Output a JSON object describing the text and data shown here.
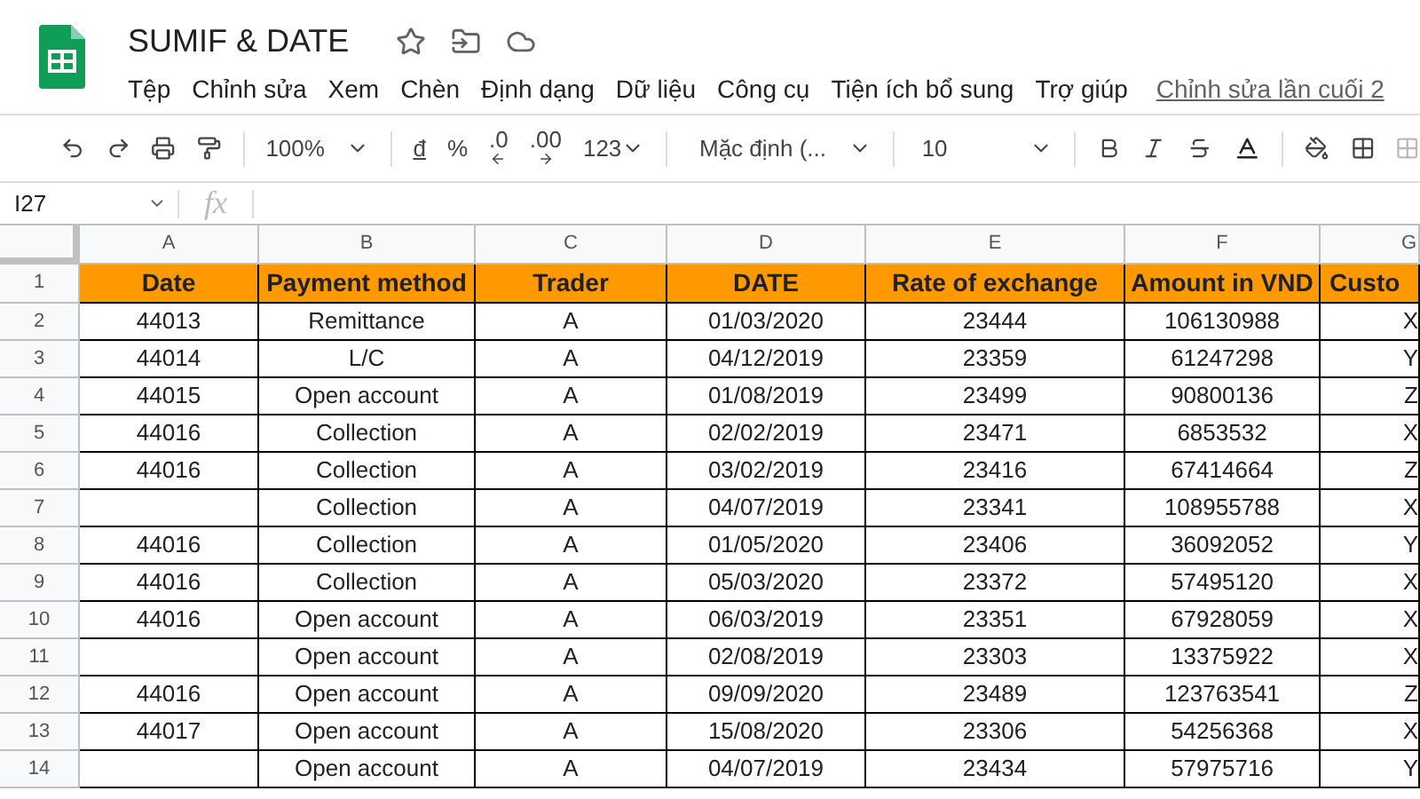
{
  "document": {
    "title": "SUMIF & DATE"
  },
  "menu": [
    "Tệp",
    "Chỉnh sửa",
    "Xem",
    "Chèn",
    "Định dạng",
    "Dữ liệu",
    "Công cụ",
    "Tiện ích bổ sung",
    "Trợ giúp"
  ],
  "last_edit": "Chỉnh sửa lần cuối 2",
  "toolbar": {
    "zoom": "100%",
    "currency": "đ",
    "percent": "%",
    "decrease_decimals": ".0",
    "increase_decimals": ".00",
    "number_format": "123",
    "font": "Mặc định (...",
    "font_size": "10"
  },
  "formula_bar": {
    "cell_ref": "I27",
    "fx": "fx"
  },
  "sheet": {
    "column_letters": [
      "A",
      "B",
      "C",
      "D",
      "E",
      "F",
      "G"
    ],
    "header": {
      "number": "1",
      "cells": [
        "Date",
        "Payment method",
        "Trader",
        "DATE",
        "Rate of exchange",
        "Amount in VND",
        "Custo"
      ]
    },
    "rows": [
      {
        "number": "2",
        "cells": [
          "44013",
          "Remittance",
          "A",
          "01/03/2020",
          "23444",
          "106130988",
          "X"
        ]
      },
      {
        "number": "3",
        "cells": [
          "44014",
          "L/C",
          "A",
          "04/12/2019",
          "23359",
          "61247298",
          "Y"
        ]
      },
      {
        "number": "4",
        "cells": [
          "44015",
          "Open account",
          "A",
          "01/08/2019",
          "23499",
          "90800136",
          "Z"
        ]
      },
      {
        "number": "5",
        "cells": [
          "44016",
          "Collection",
          "A",
          "02/02/2019",
          "23471",
          "6853532",
          "X"
        ]
      },
      {
        "number": "6",
        "cells": [
          "44016",
          "Collection",
          "A",
          "03/02/2019",
          "23416",
          "67414664",
          "Z"
        ]
      },
      {
        "number": "7",
        "cells": [
          "",
          "Collection",
          "A",
          "04/07/2019",
          "23341",
          "108955788",
          "X"
        ]
      },
      {
        "number": "8",
        "cells": [
          "44016",
          "Collection",
          "A",
          "01/05/2020",
          "23406",
          "36092052",
          "Y"
        ]
      },
      {
        "number": "9",
        "cells": [
          "44016",
          "Collection",
          "A",
          "05/03/2020",
          "23372",
          "57495120",
          "X"
        ]
      },
      {
        "number": "10",
        "cells": [
          "44016",
          "Open account",
          "A",
          "06/03/2019",
          "23351",
          "67928059",
          "X"
        ]
      },
      {
        "number": "11",
        "cells": [
          "",
          "Open account",
          "A",
          "02/08/2019",
          "23303",
          "13375922",
          "X"
        ]
      },
      {
        "number": "12",
        "cells": [
          "44016",
          "Open account",
          "A",
          "09/09/2020",
          "23489",
          "123763541",
          "Z"
        ]
      },
      {
        "number": "13",
        "cells": [
          "44017",
          "Open account",
          "A",
          "15/08/2020",
          "23306",
          "54256368",
          "X"
        ]
      },
      {
        "number": "14",
        "cells": [
          "",
          "Open account",
          "A",
          "04/07/2019",
          "23434",
          "57975716",
          "Y"
        ]
      }
    ]
  }
}
